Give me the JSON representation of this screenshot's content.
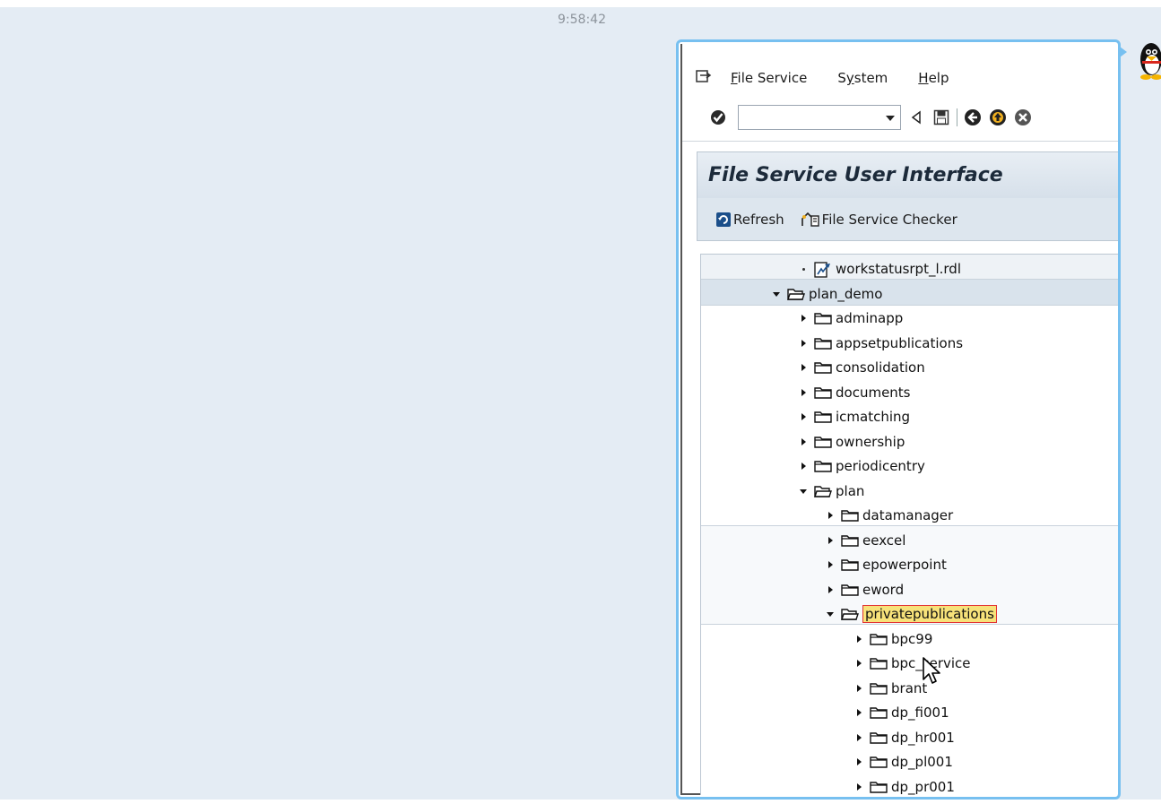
{
  "clock": "9:58:42",
  "menu": {
    "items": [
      {
        "label": "File Service",
        "hotkey_index": 0
      },
      {
        "label": "System",
        "hotkey_index": 1
      },
      {
        "label": "Help",
        "hotkey_index": 0
      }
    ]
  },
  "toolbar": {
    "command_value": "",
    "icons": [
      "check-icon",
      "back-nav-icon",
      "save-icon",
      "back-icon",
      "exit-icon",
      "cancel-icon"
    ]
  },
  "title": "File Service User Interface",
  "actions": {
    "refresh_label": "Refresh",
    "checker_label": "File Service Checker"
  },
  "tree": {
    "rows": [
      {
        "label": "workstatusrpt_l.rdl",
        "type": "file",
        "level": 3
      },
      {
        "label": "plan_demo",
        "type": "open",
        "level": 2
      },
      {
        "label": "adminapp",
        "type": "closed",
        "level": 3
      },
      {
        "label": "appsetpublications",
        "type": "closed",
        "level": 3
      },
      {
        "label": "consolidation",
        "type": "closed",
        "level": 3
      },
      {
        "label": "documents",
        "type": "closed",
        "level": 3
      },
      {
        "label": "icmatching",
        "type": "closed",
        "level": 3
      },
      {
        "label": "ownership",
        "type": "closed",
        "level": 3
      },
      {
        "label": "periodicentry",
        "type": "closed",
        "level": 3
      },
      {
        "label": "plan",
        "type": "open",
        "level": 3
      },
      {
        "label": "datamanager",
        "type": "closed",
        "level": 4
      },
      {
        "label": "eexcel",
        "type": "closed",
        "level": 4
      },
      {
        "label": "epowerpoint",
        "type": "closed",
        "level": 4
      },
      {
        "label": "eword",
        "type": "closed",
        "level": 4
      },
      {
        "label": "privatepublications",
        "type": "open",
        "level": 4,
        "selected": true
      },
      {
        "label": "bpc99",
        "type": "closed",
        "level": 5
      },
      {
        "label": "bpc_service",
        "type": "closed",
        "level": 5
      },
      {
        "label": "brant",
        "type": "closed",
        "level": 5
      },
      {
        "label": "dp_fi001",
        "type": "closed",
        "level": 5
      },
      {
        "label": "dp_hr001",
        "type": "closed",
        "level": 5
      },
      {
        "label": "dp_pl001",
        "type": "closed",
        "level": 5
      },
      {
        "label": "dp_pr001",
        "type": "closed",
        "level": 5
      }
    ]
  },
  "colors": {
    "selection": "#f7e27a",
    "selection_border": "#e23333",
    "frame": "#77c0f0"
  }
}
